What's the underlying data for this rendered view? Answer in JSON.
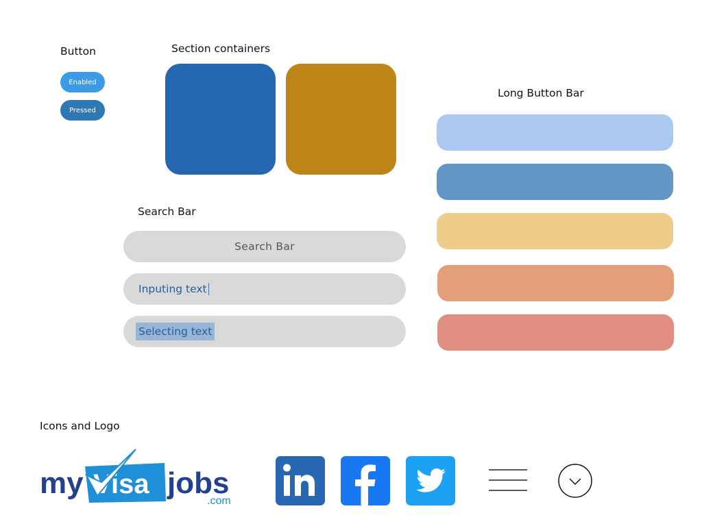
{
  "button_section": {
    "title": "Button",
    "enabled_label": "Enabled",
    "pressed_label": "Pressed"
  },
  "containers_section": {
    "title": "Section containers"
  },
  "search_section": {
    "title": "Search Bar",
    "placeholder_label": "Search Bar",
    "input_text": "Inputing text",
    "selected_text": "Selecting text"
  },
  "long_bar_section": {
    "title": "Long Button Bar"
  },
  "icons_section": {
    "title": "Icons and Logo",
    "logo": {
      "part1": "my",
      "part2": "Visa",
      "part3": "jobs",
      "part4": ".com"
    },
    "icons": [
      "linkedin-icon",
      "facebook-icon",
      "twitter-icon",
      "menu-icon",
      "chevron-down-circle-icon"
    ]
  },
  "colors": {
    "enabled": "#3d9be5",
    "pressed": "#2e78b5",
    "container_blue": "#2567b0",
    "container_gold": "#bd8417",
    "bar1": "#abc8f2",
    "bar2": "#6196c7",
    "bar3": "#edcd89",
    "bar4": "#e39e7a",
    "bar5": "#e18e82",
    "linkedin": "#2867b2",
    "facebook": "#1877f2",
    "twitter": "#1da1f2"
  }
}
